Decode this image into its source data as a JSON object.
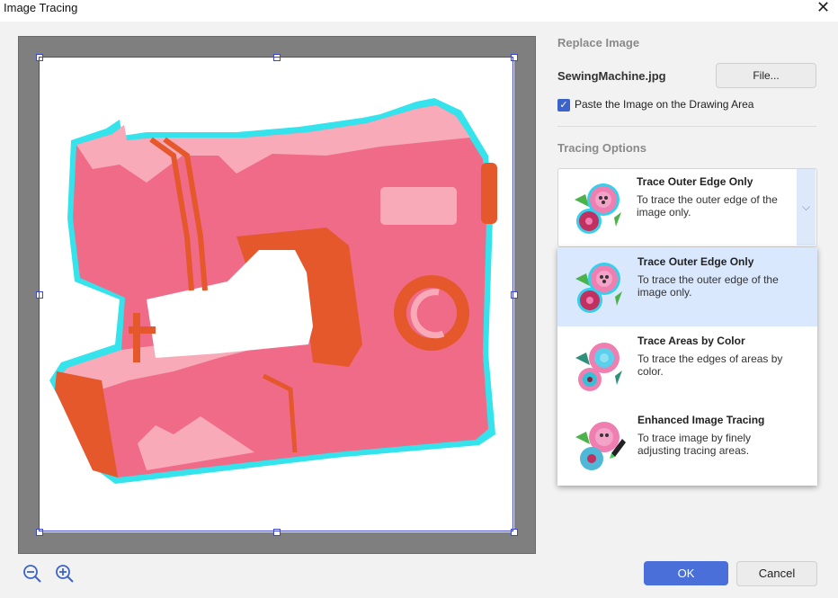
{
  "window": {
    "title": "Image Tracing"
  },
  "replace_image": {
    "heading": "Replace Image",
    "file_name": "SewingMachine.jpg",
    "file_button": "File...",
    "paste_checkbox": {
      "label": "Paste the Image on the Drawing Area",
      "checked": true
    }
  },
  "tracing_options": {
    "heading": "Tracing Options",
    "selected": {
      "title": "Trace Outer Edge Only",
      "description": "To trace the outer edge of the image only."
    },
    "options": [
      {
        "title": "Trace Outer Edge Only",
        "description": "To trace the outer edge of the image only.",
        "icon": "flower-outline-icon",
        "selected": true
      },
      {
        "title": "Trace Areas by Color",
        "description": "To trace the edges of areas by color.",
        "icon": "flower-color-areas-icon",
        "selected": false
      },
      {
        "title": "Enhanced Image Tracing",
        "description": "To trace image by finely adjusting tracing areas.",
        "icon": "flower-pen-icon",
        "selected": false
      }
    ]
  },
  "canvas": {
    "image": "sewing-machine-image"
  },
  "footer": {
    "ok_label": "OK",
    "cancel_label": "Cancel"
  },
  "zoom": {
    "out_icon": "zoom-out-icon",
    "in_icon": "zoom-in-icon"
  },
  "colors": {
    "accent": "#4a6fd9",
    "selection_bg": "#d9e8fd",
    "trace_outline": "#35e3ec",
    "machine_pink": "#f06b87",
    "machine_orange": "#e4582b"
  }
}
